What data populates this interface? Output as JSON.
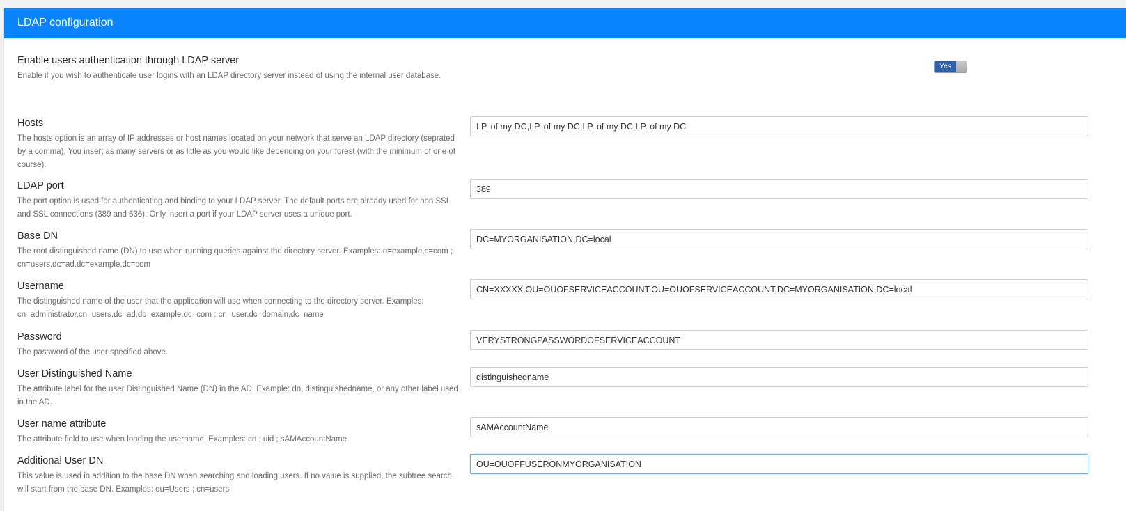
{
  "panel": {
    "title": "LDAP configuration"
  },
  "enable": {
    "label": "Enable users authentication through LDAP server",
    "description": "Enable if you wish to authenticate user logins with an LDAP directory server instead of using the internal user database.",
    "toggle_label": "Yes",
    "toggle_state": true,
    "accent_color": "#0a84ff"
  },
  "fields": [
    {
      "label": "Hosts",
      "description": "The hosts option is an array of IP addresses or host names located on your network that serve an LDAP directory (seprated by a comma). You insert as many servers or as little as you would like depending on your forest (with the minimum of one of course).",
      "value": "I.P. of my DC,I.P. of my DC,I.P. of my DC,I.P. of my DC"
    },
    {
      "label": "LDAP port",
      "description": "The port option is used for authenticating and binding to your LDAP server. The default ports are already used for non SSL and SSL connections (389 and 636). Only insert a port if your LDAP server uses a unique port.",
      "value": "389"
    },
    {
      "label": "Base DN",
      "description": "The root distinguished name (DN) to use when running queries against the directory server. Examples: o=example,c=com ; cn=users,dc=ad,dc=example,dc=com",
      "value": "DC=MYORGANISATION,DC=local"
    },
    {
      "label": "Username",
      "description": "The distinguished name of the user that the application will use when connecting to the directory server. Examples: cn=administrator,cn=users,dc=ad,dc=example,dc=com ; cn=user,dc=domain,dc=name",
      "value": "CN=XXXXX,OU=OUOFSERVICEACCOUNT,OU=OUOFSERVICEACCOUNT,DC=MYORGANISATION,DC=local"
    },
    {
      "label": "Password",
      "description": "The password of the user specified above.",
      "value": "VERYSTRONGPASSWORDOFSERVICEACCOUNT"
    },
    {
      "label": "User Distinguished Name",
      "description": "The attribute label for the user Distinguished Name (DN) in the AD. Example: dn, distinguishedname, or any other label used in the AD.",
      "value": "distinguishedname"
    },
    {
      "label": "User name attribute",
      "description": "The attribute field to use when loading the username. Examples: cn ; uid ; sAMAccountName",
      "value": "sAMAccountName"
    },
    {
      "label": "Additional User DN",
      "description": "This value is used in addition to the base DN when searching and loading users. If no value is supplied, the subtree search will start from the base DN. Examples: ou=Users ; cn=users",
      "value": "OU=OUOFFUSERONMYORGANISATION"
    }
  ]
}
